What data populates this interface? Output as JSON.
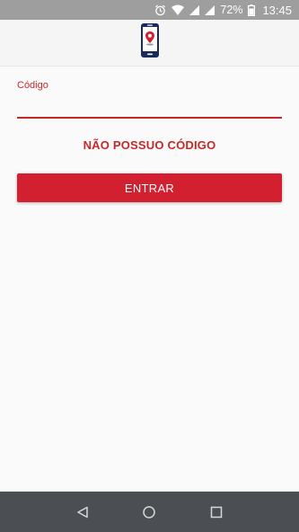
{
  "status_bar": {
    "battery_percent": "72%",
    "time": "13:45",
    "icons": [
      "alarm-icon",
      "wifi-icon",
      "signal-icon",
      "signal-icon",
      "battery-icon"
    ]
  },
  "app_bar": {
    "logo_icon": "phone-location-pin-icon"
  },
  "form": {
    "code_label": "Código",
    "code_value": "",
    "no_code_link": "NÃO POSSUO CÓDIGO",
    "enter_button": "ENTRAR"
  },
  "nav_bar": {
    "icons": [
      "back-triangle-icon",
      "home-circle-icon",
      "recents-square-icon"
    ]
  },
  "colors": {
    "accent": "#c62828",
    "button": "#d32030",
    "status_bar": "#9e9e9e",
    "nav_bar": "#4b4f54",
    "logo_navy": "#1a2a5a"
  }
}
